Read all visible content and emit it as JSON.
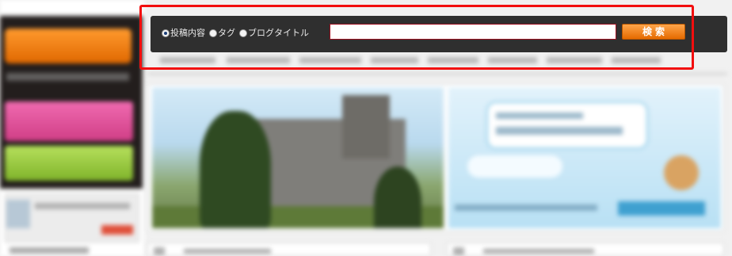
{
  "search": {
    "options": [
      {
        "label": "投稿内容",
        "checked": true
      },
      {
        "label": "タグ",
        "checked": false
      },
      {
        "label": "ブログタイトル",
        "checked": false
      }
    ],
    "input_value": "",
    "button_label": "検索"
  },
  "colors": {
    "search_bar_bg": "#2f2f2f",
    "search_button": "#ff8c1a",
    "highlight": "#f20e0e"
  }
}
